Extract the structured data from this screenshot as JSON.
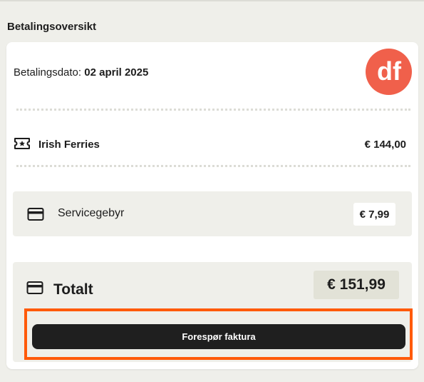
{
  "section_title": "Betalingsoversikt",
  "payment": {
    "date_label": "Betalingsdato:",
    "date_value": "02 april 2025"
  },
  "logo": {
    "text": "df",
    "color": "#f0604b"
  },
  "ferry": {
    "icon": "ticket-star-icon",
    "name": "Irish Ferries",
    "price": "€ 144,00"
  },
  "service_fee": {
    "icon": "credit-card-icon",
    "label": "Servicegebyr",
    "price": "€ 7,99"
  },
  "total": {
    "icon": "credit-card-icon",
    "label": "Totalt",
    "price": "€ 151,99"
  },
  "invoice_button": {
    "label": "Forespør faktura"
  },
  "colors": {
    "highlight": "#ff5a0a",
    "button": "#1f1f1f",
    "panel": "#efefea"
  }
}
